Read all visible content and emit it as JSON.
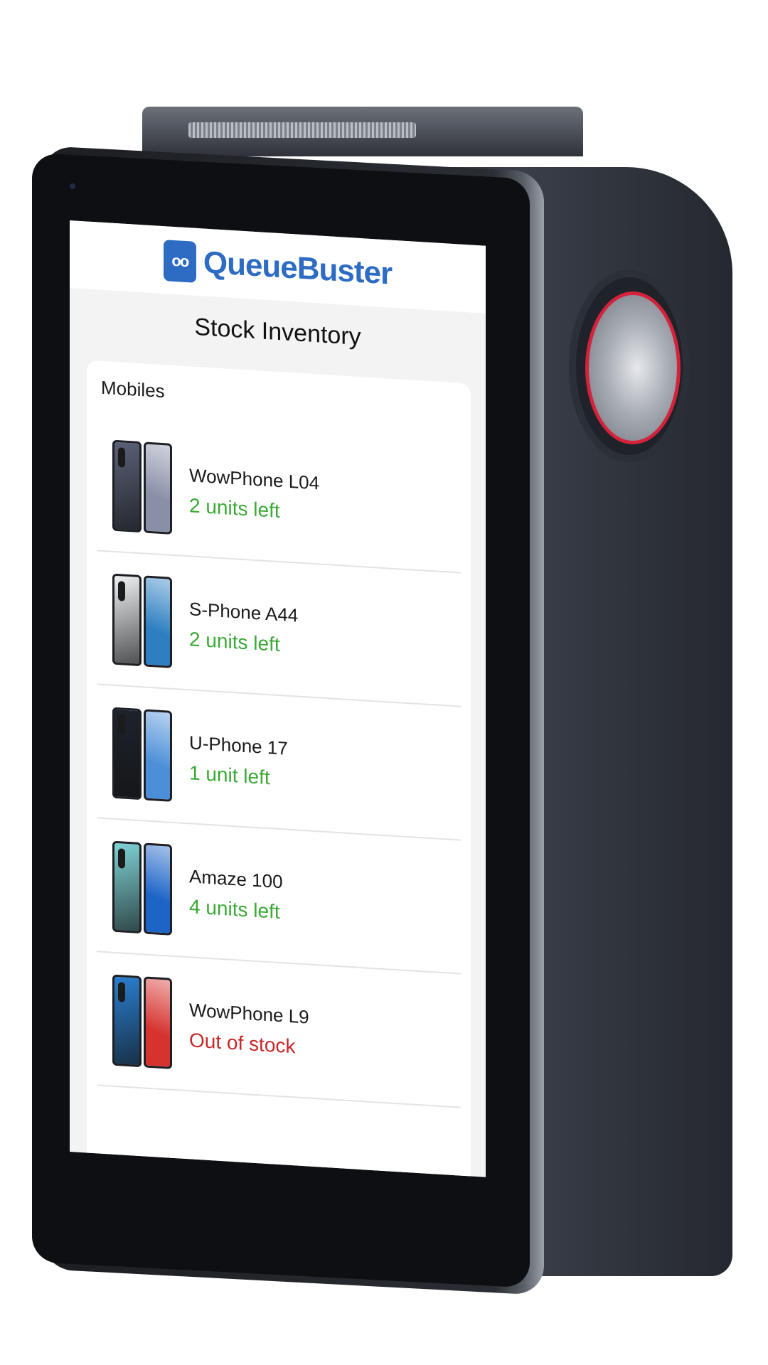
{
  "brand": {
    "logo_mark": "oo",
    "name": "QueueBuster",
    "color": "#2e6cc4"
  },
  "page": {
    "title": "Stock Inventory"
  },
  "section": {
    "title": "Mobiles"
  },
  "colors": {
    "in_stock": "#3aa935",
    "out_of_stock": "#c62828",
    "device_body": "#2f333b",
    "dial_ring": "#d4223b"
  },
  "items": [
    {
      "name": "WowPhone L04",
      "status": "2 units left",
      "in_stock": true,
      "thumb": {
        "front": "#5a6178",
        "back": "#8a8fa8",
        "icon": "phone-image"
      }
    },
    {
      "name": "S-Phone A44",
      "status": "2 units left",
      "in_stock": true,
      "thumb": {
        "front": "#eef0f2",
        "back": "#2d7fc2",
        "icon": "phone-image"
      }
    },
    {
      "name": "U-Phone 17",
      "status": "1 unit left",
      "in_stock": true,
      "thumb": {
        "front": "#1e232c",
        "back": "#4c8fd8",
        "icon": "phone-image"
      }
    },
    {
      "name": "Amaze 100",
      "status": "4 units left",
      "in_stock": true,
      "thumb": {
        "front": "#7fd3d6",
        "back": "#1d64c7",
        "icon": "phone-image"
      }
    },
    {
      "name": "WowPhone L9",
      "status": "Out of stock",
      "in_stock": false,
      "thumb": {
        "front": "#2a7fd0",
        "back": "#d6332f",
        "icon": "phone-image"
      }
    }
  ]
}
